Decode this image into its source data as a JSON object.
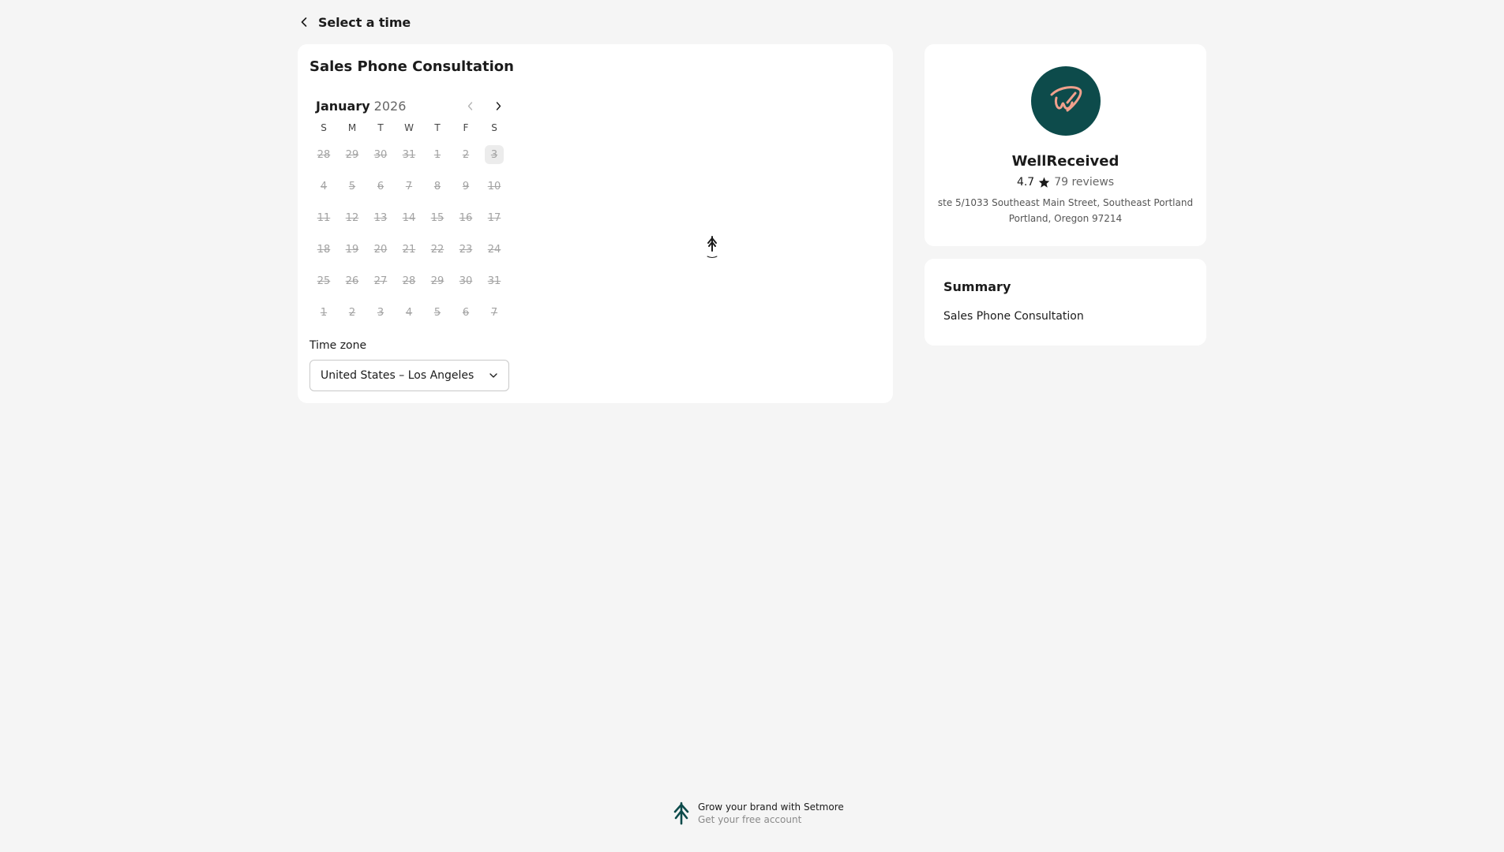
{
  "header": {
    "title": "Select a time"
  },
  "service": {
    "title": "Sales Phone Consultation"
  },
  "calendar": {
    "month": "January",
    "year": "2026",
    "weekdays": [
      "S",
      "M",
      "T",
      "W",
      "T",
      "F",
      "S"
    ],
    "days": [
      "28",
      "29",
      "30",
      "31",
      "1",
      "2",
      "3",
      "4",
      "5",
      "6",
      "7",
      "8",
      "9",
      "10",
      "11",
      "12",
      "13",
      "14",
      "15",
      "16",
      "17",
      "18",
      "19",
      "20",
      "21",
      "22",
      "23",
      "24",
      "25",
      "26",
      "27",
      "28",
      "29",
      "30",
      "31",
      "1",
      "2",
      "3",
      "4",
      "5",
      "6",
      "7"
    ],
    "highlighted_day": "3"
  },
  "timezone": {
    "label": "Time zone",
    "value": "United States – Los Angeles"
  },
  "business": {
    "name": "WellReceived",
    "rating": "4.7",
    "reviews": "79 reviews",
    "address_line1": "ste 5/1033 Southeast Main Street, Southeast Portland",
    "address_line2": "Portland, Oregon 97214",
    "logo_bg": "#0d4b4b",
    "logo_fg": "#f0a08c"
  },
  "summary": {
    "title": "Summary",
    "item": "Sales Phone Consultation"
  },
  "footer": {
    "line1": "Grow your brand with Setmore",
    "line2": "Get your free account"
  },
  "icons": {
    "back": "chevron-left-icon",
    "prev_month": "chevron-left-icon",
    "next_month": "chevron-right-icon",
    "dropdown": "chevron-down-icon",
    "star": "star-icon",
    "brand": "setmore-logo-icon"
  }
}
